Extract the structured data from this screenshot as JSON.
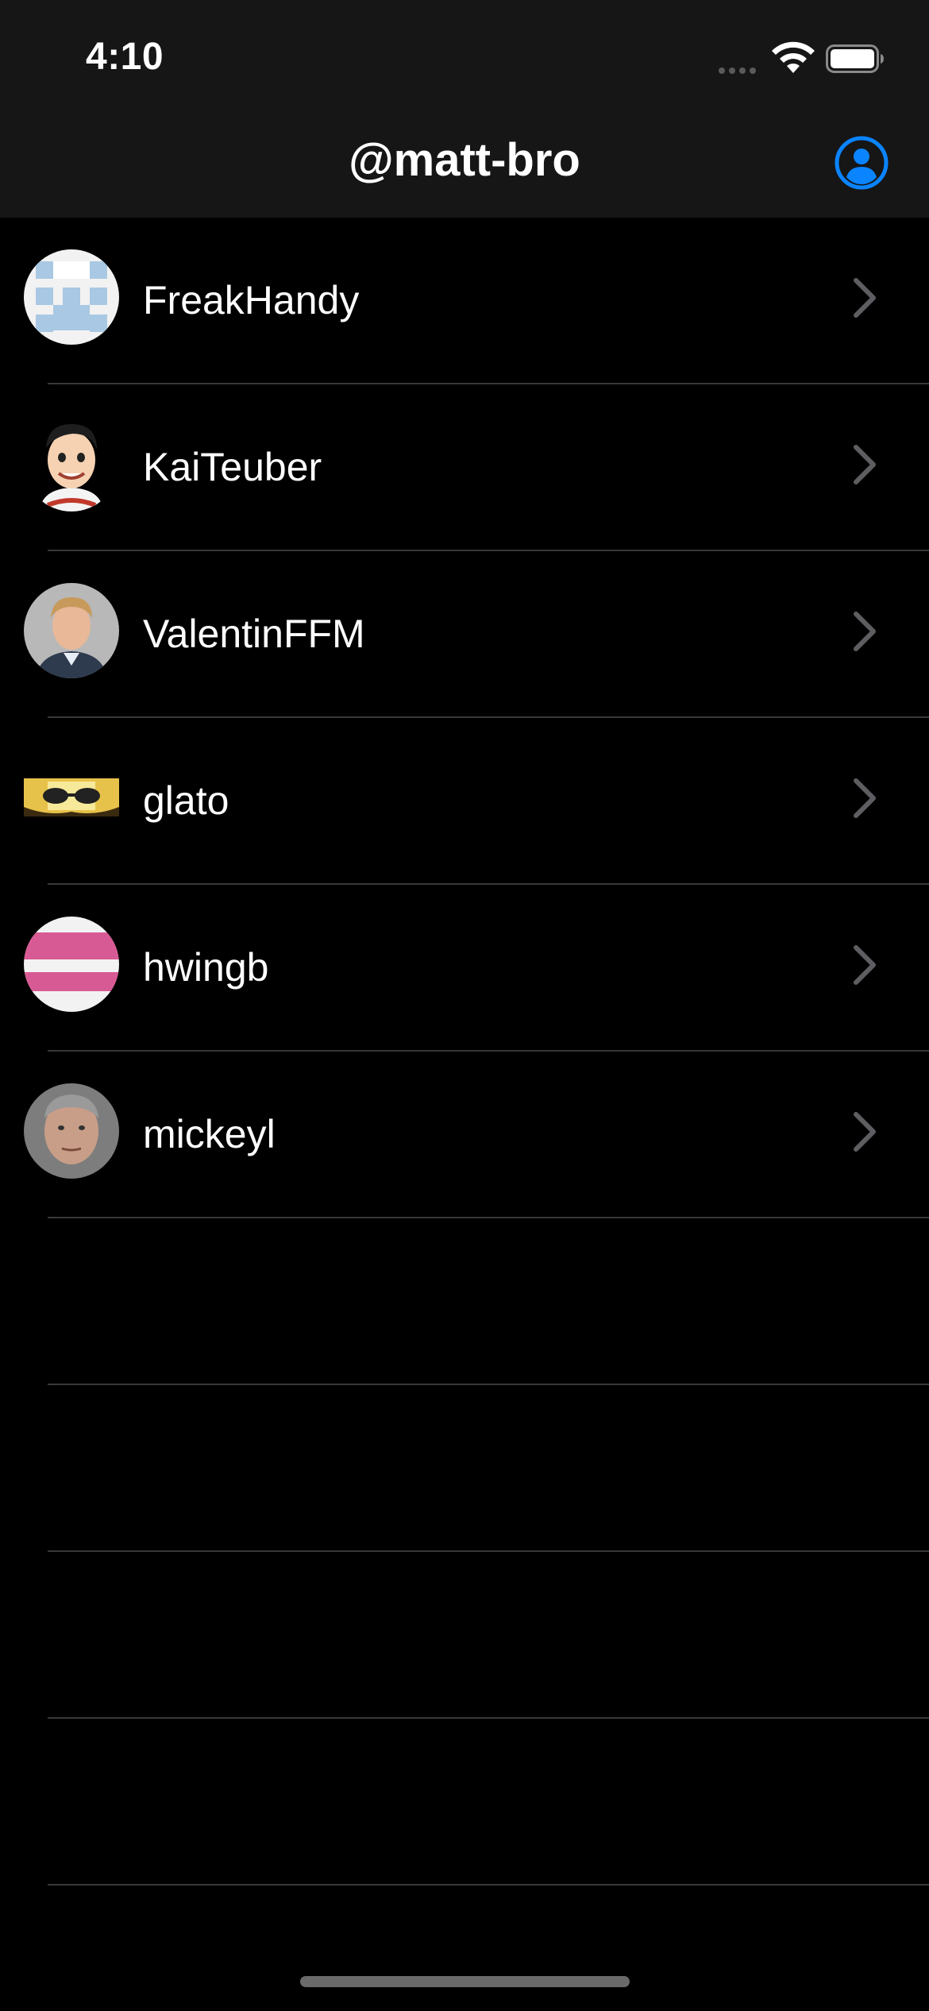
{
  "status_bar": {
    "time": "4:10",
    "wifi_icon": "wifi-icon",
    "battery_icon": "battery-icon"
  },
  "nav": {
    "title": "@matt-bro",
    "profile_icon": "person-circle-icon",
    "accent_color": "#0a84ff"
  },
  "users": [
    {
      "name": "FreakHandy",
      "avatar": "identicon-blue"
    },
    {
      "name": "KaiTeuber",
      "avatar": "cartoon-face"
    },
    {
      "name": "ValentinFFM",
      "avatar": "photo-portrait"
    },
    {
      "name": "glato",
      "avatar": "photo-sunglasses"
    },
    {
      "name": "hwingb",
      "avatar": "identicon-pink"
    },
    {
      "name": "mickeyl",
      "avatar": "photo-portrait"
    }
  ],
  "chevron_icon": "chevron-right-icon"
}
